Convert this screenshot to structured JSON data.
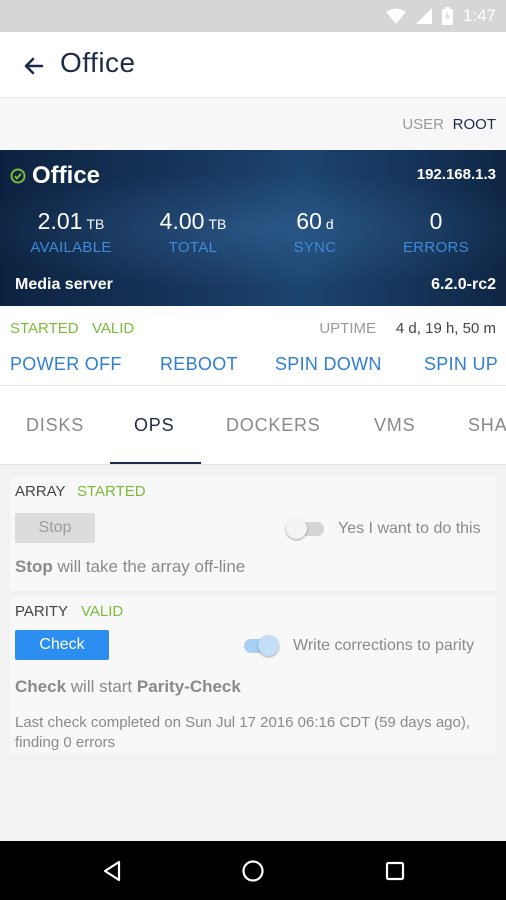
{
  "status_bar": {
    "time": "1:47",
    "icons": [
      "wifi-icon",
      "signal-icon",
      "battery-icon"
    ]
  },
  "app_bar": {
    "title": "Office",
    "back_icon": "arrow-left-icon"
  },
  "user": {
    "label": "USER",
    "value": "ROOT"
  },
  "server": {
    "name": "Office",
    "status_icon": "check-circle-icon",
    "ip": "192.168.1.3",
    "stats": [
      {
        "value": "2.01",
        "unit": "TB",
        "label": "AVAILABLE"
      },
      {
        "value": "4.00",
        "unit": "TB",
        "label": "TOTAL"
      },
      {
        "value": "60",
        "unit": "d",
        "label": "SYNC"
      },
      {
        "value": "0",
        "unit": "",
        "label": "ERRORS"
      }
    ],
    "description": "Media server",
    "version": "6.2.0-rc2"
  },
  "state": {
    "started": "STARTED",
    "valid": "VALID",
    "uptime_label": "UPTIME",
    "uptime_value": "4 d, 19 h, 50 m"
  },
  "actions": [
    "POWER OFF",
    "REBOOT",
    "SPIN DOWN",
    "SPIN UP"
  ],
  "tabs": [
    "DISKS",
    "OPS",
    "DOCKERS",
    "VMS",
    "SHA"
  ],
  "active_tab": "OPS",
  "array": {
    "title": "ARRAY",
    "status": "STARTED",
    "button": "Stop",
    "toggle_label": "Yes I want to do this",
    "toggle_on": false,
    "hint_bold": "Stop",
    "hint_rest": "will take the array off-line"
  },
  "parity": {
    "title": "PARITY",
    "status": "VALID",
    "button": "Check",
    "toggle_label": "Write corrections to parity",
    "toggle_on": true,
    "hint_bold1": "Check",
    "hint_mid": "will start",
    "hint_bold2": "Parity-Check",
    "last_check": "Last check completed on Sun Jul 17 2016 06:16 CDT (59 days ago), finding 0 errors"
  },
  "nav": [
    "back-triangle-icon",
    "home-circle-icon",
    "recents-square-icon"
  ],
  "colors": {
    "accent": "#2e7fd1",
    "ok_green": "#7dba3a",
    "navy": "#1c2b4a",
    "button_blue": "#2c8ef0"
  }
}
